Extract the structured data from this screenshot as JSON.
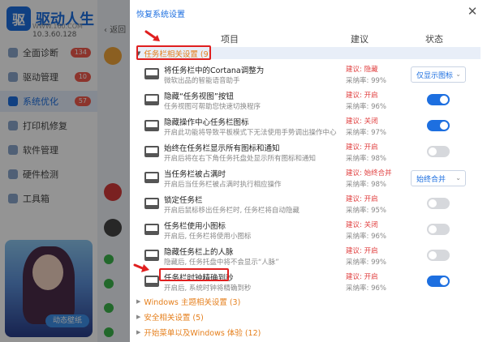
{
  "background_app": {
    "logo_text": "驱动人生",
    "website": "WWW.160.COM",
    "version": "10.3.60.128",
    "nav": [
      {
        "label": "全面诊断",
        "badge": "134"
      },
      {
        "label": "驱动管理",
        "badge": "10"
      },
      {
        "label": "系统优化",
        "badge": "57"
      },
      {
        "label": "打印机修复",
        "badge": ""
      },
      {
        "label": "软件管理",
        "badge": ""
      },
      {
        "label": "硬件检测",
        "badge": ""
      },
      {
        "label": "工具箱",
        "badge": ""
      }
    ],
    "back_label": "返回",
    "promo_label": "动态壁纸"
  },
  "dialog": {
    "title": "恢复系统设置",
    "close_glyph": "✕",
    "columns": {
      "item": "项目",
      "suggest": "建议",
      "status": "状态"
    },
    "groups": {
      "taskbar": {
        "label": "任务栏相关设置 (9)",
        "glyph": "▼"
      },
      "windows_theme": {
        "label": "Windows 主题相关设置 (3)",
        "glyph": "▶"
      },
      "security": {
        "label": "安全相关设置 (5)",
        "glyph": "▶"
      },
      "start_menu": {
        "label": "开始菜单以及Windows 体验 (12)",
        "glyph": "▶"
      }
    },
    "rows": [
      {
        "name": "将任务栏中的Cortana调整为",
        "desc": "微软出品的智能语音助手",
        "suggest": "建议: 隐藏",
        "rate": "采纳率: 99%",
        "control": "select",
        "select_value": "仅显示图标",
        "on": false
      },
      {
        "name": "隐藏“任务视图”按钮",
        "desc": "任务视图可帮助您快速切换程序",
        "suggest": "建议: 开启",
        "rate": "采纳率: 96%",
        "control": "toggle",
        "select_value": "",
        "on": true
      },
      {
        "name": "隐藏操作中心任务栏图标",
        "desc": "开启此功能将导致平板模式下无法使用手势调出操作中心",
        "suggest": "建议: 关闭",
        "rate": "采纳率: 97%",
        "control": "toggle",
        "select_value": "",
        "on": true
      },
      {
        "name": "始终在任务栏显示所有图标和通知",
        "desc": "开启后将在右下角任务托盘处显示所有图标和通知",
        "suggest": "建议: 开启",
        "rate": "采纳率: 98%",
        "control": "toggle",
        "select_value": "",
        "on": false
      },
      {
        "name": "当任务栏被占满时",
        "desc": "开启后当任务栏被占满时执行相应操作",
        "suggest": "建议: 始终合并",
        "rate": "采纳率: 98%",
        "control": "select",
        "select_value": "始终合并",
        "on": false
      },
      {
        "name": "锁定任务栏",
        "desc": "开启后鼠标移出任务栏时, 任务栏将自动隐藏",
        "suggest": "建议: 开启",
        "rate": "采纳率: 95%",
        "control": "toggle",
        "select_value": "",
        "on": false
      },
      {
        "name": "任务栏使用小图标",
        "desc": "开启后, 任务栏将使用小图标",
        "suggest": "建议: 关闭",
        "rate": "采纳率: 96%",
        "control": "toggle",
        "select_value": "",
        "on": false
      },
      {
        "name": "隐藏任务栏上的人脉",
        "desc": "隐藏后, 任务托盘中将不会显示“人脉”",
        "suggest": "建议: 开启",
        "rate": "采纳率: 99%",
        "control": "toggle",
        "select_value": "",
        "on": false
      },
      {
        "name": "任务栏时钟精确到秒",
        "desc": "开启后, 系统时钟将精确到秒",
        "suggest": "建议: 开启",
        "rate": "采纳率: 96%",
        "control": "toggle",
        "select_value": "",
        "on": true
      }
    ]
  },
  "colors": {
    "accent": "#1d6fe0",
    "warning": "#e03d3d",
    "group_text": "#e57f1c",
    "highlight_box": "#e01f1f"
  }
}
